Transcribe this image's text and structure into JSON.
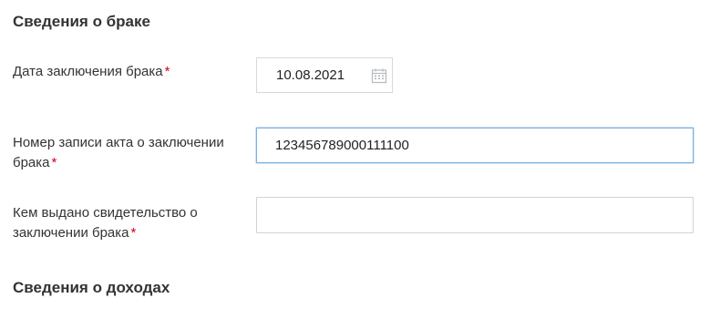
{
  "marriage_section": {
    "title": "Сведения о браке",
    "date_field": {
      "label": "Дата заключения брака",
      "required_mark": "*",
      "value": "10.08.2021",
      "icon": "calendar-icon"
    },
    "record_number_field": {
      "label_line1": "Номер записи акта о заключении",
      "label_line2": "брака",
      "required_mark": "*",
      "value": "123456789000111100",
      "focused": true
    },
    "issued_by_field": {
      "label_line1": "Кем выдано свидетельство о",
      "label_line2": "заключении брака",
      "required_mark": "*",
      "value": ""
    }
  },
  "income_section": {
    "title": "Сведения о доходах"
  },
  "colors": {
    "required": "#d0021b",
    "focus_border": "#7ab0dd",
    "input_border": "#cfd3d7",
    "text": "#333333"
  }
}
